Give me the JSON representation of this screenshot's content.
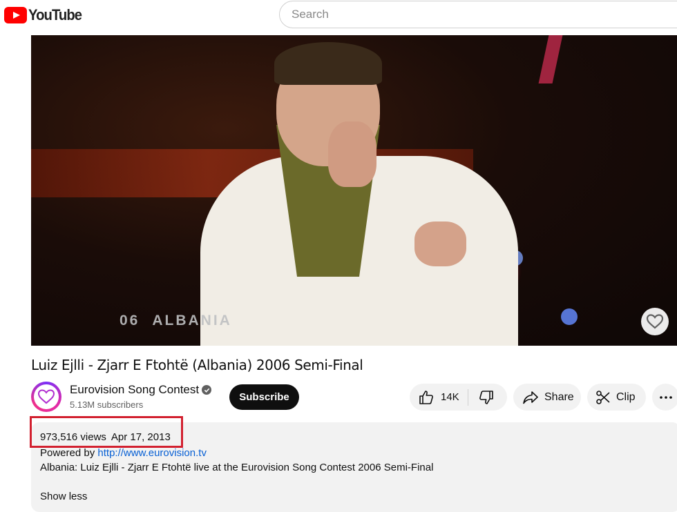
{
  "header": {
    "logo_text": "YouTube",
    "search_placeholder": "Search"
  },
  "video": {
    "overlay_number": "06",
    "overlay_country": "ALBANIA"
  },
  "title": "Luiz Ejlli - Zjarr E Ftohtë (Albania) 2006 Semi-Final",
  "channel": {
    "name": "Eurovision Song Contest",
    "subscribers": "5.13M subscribers",
    "verified_icon": "check-circle-icon"
  },
  "actions": {
    "subscribe_label": "Subscribe",
    "like_count": "14K",
    "share_label": "Share",
    "clip_label": "Clip"
  },
  "description": {
    "views": "973,516 views",
    "date": "Apr 17, 2013",
    "powered_by": "Powered by ",
    "link": "http://www.eurovision.tv",
    "body": "Albania: Luiz Ejlli - Zjarr E Ftohtë live at the Eurovision Song Contest 2006 Semi-Final",
    "show_less": "Show less"
  },
  "colors": {
    "brand_red": "#ff0000",
    "highlight_box": "#d2202f",
    "link": "#065fd4"
  }
}
